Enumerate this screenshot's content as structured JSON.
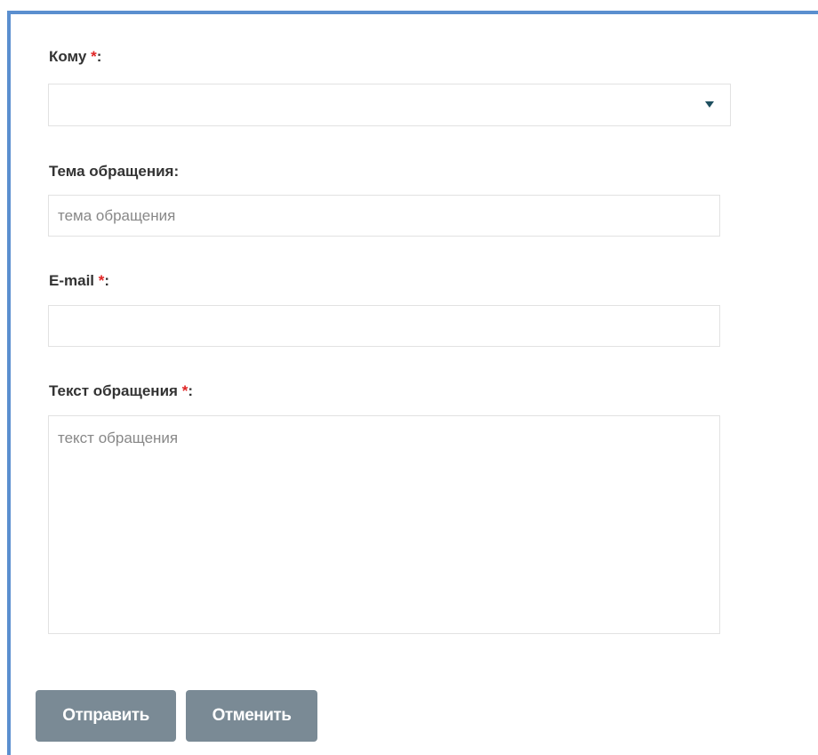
{
  "form": {
    "to": {
      "label": "Кому",
      "required_mark": "*",
      "colon": ":",
      "selected_value": ""
    },
    "subject": {
      "label": "Тема обращения:",
      "placeholder": "тема обращения",
      "value": ""
    },
    "email": {
      "label": "E-mail",
      "required_mark": "*",
      "colon": ":",
      "value": ""
    },
    "message": {
      "label": "Текст обращения",
      "required_mark": "*",
      "colon": ":",
      "placeholder": "текст обращения",
      "value": ""
    },
    "buttons": {
      "submit_label": "Отправить",
      "cancel_label": "Отменить"
    }
  },
  "colors": {
    "frame_border": "#5b8fcf",
    "required_mark": "#e02424",
    "button_bg": "#7a8a95",
    "chevron": "#1e4f5f"
  },
  "icons": {
    "select_arrow": "chevron-down-icon"
  }
}
